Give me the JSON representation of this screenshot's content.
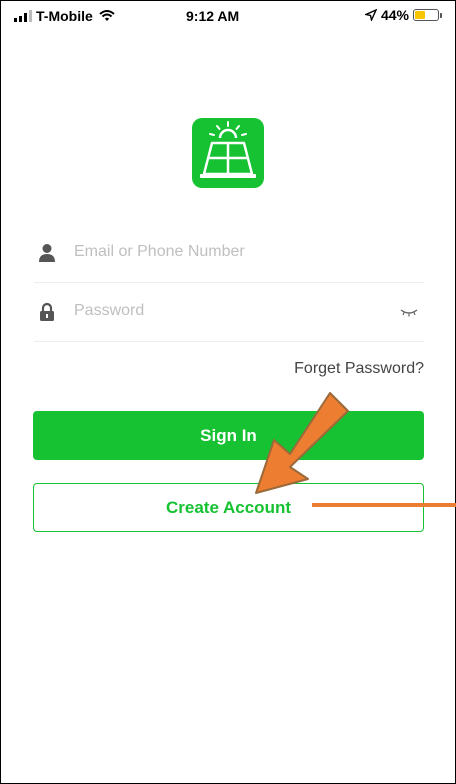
{
  "status_bar": {
    "carrier": "T-Mobile",
    "time": "9:12 AM",
    "battery_percent": "44%",
    "battery_level": 0.44,
    "battery_color": "#f7c600"
  },
  "app_logo": {
    "icon": "solar-panel-icon",
    "color": "#16c232"
  },
  "login_form": {
    "email_placeholder": "Email or Phone Number",
    "password_placeholder": "Password",
    "forget_password_label": "Forget Password?",
    "sign_in_label": "Sign In",
    "create_account_label": "Create Account"
  },
  "colors": {
    "accent": "#16c232",
    "annotation": "#ed7d31"
  }
}
